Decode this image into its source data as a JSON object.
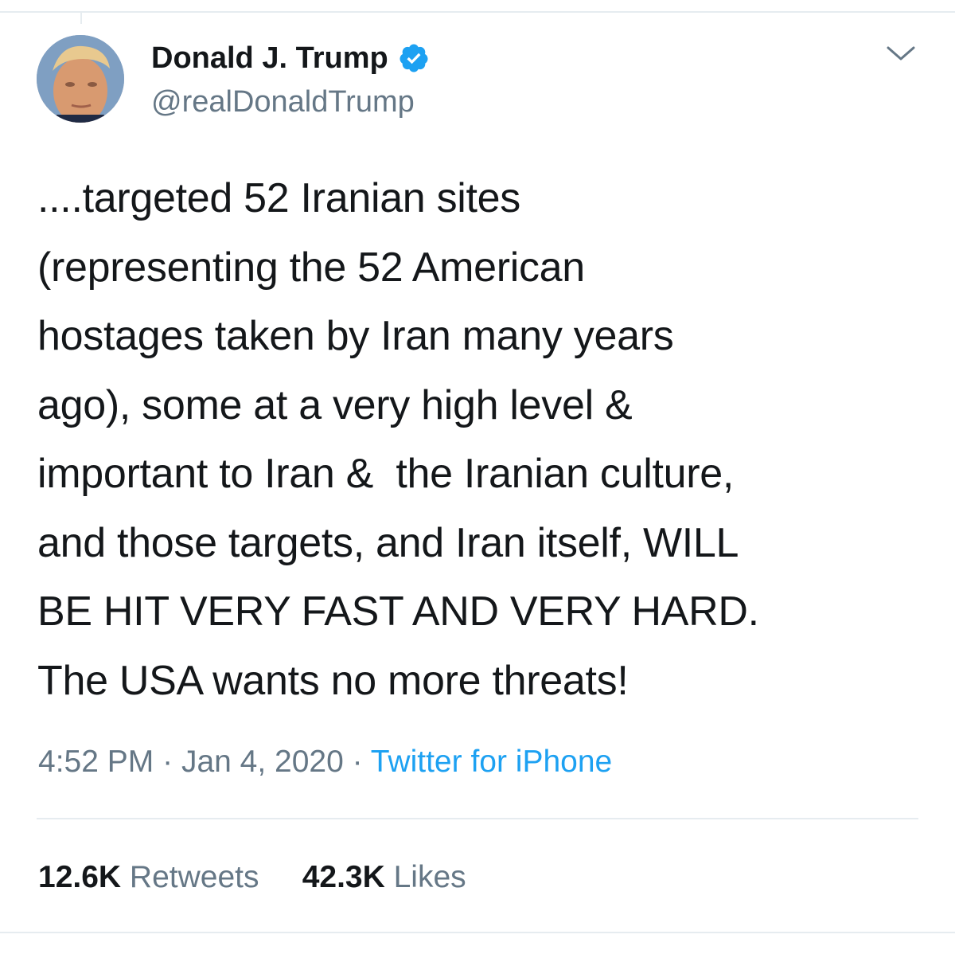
{
  "tweet": {
    "author": {
      "display_name": "Donald J. Trump",
      "handle": "@realDonaldTrump",
      "verified": true
    },
    "text": "....targeted 52 Iranian sites\n(representing the 52 American\nhostages taken by Iran many years\nago), some at a very high level &\nimportant to Iran &  the Iranian culture,\nand those targets, and Iran itself, WILL\nBE HIT VERY FAST AND VERY HARD.\nThe USA wants no more threats!",
    "time": "4:52 PM",
    "separator": "·",
    "date": "Jan 4, 2020",
    "source": "Twitter for iPhone",
    "retweets_count": "12.6K",
    "retweets_label": "Retweets",
    "likes_count": "42.3K",
    "likes_label": "Likes"
  },
  "icons": {
    "verified": "verified-badge-icon",
    "menu": "chevron-down-icon"
  },
  "colors": {
    "link": "#1da1f2",
    "secondary_text": "#657786",
    "primary_text": "#14171a",
    "divider": "#e6ecf0"
  }
}
